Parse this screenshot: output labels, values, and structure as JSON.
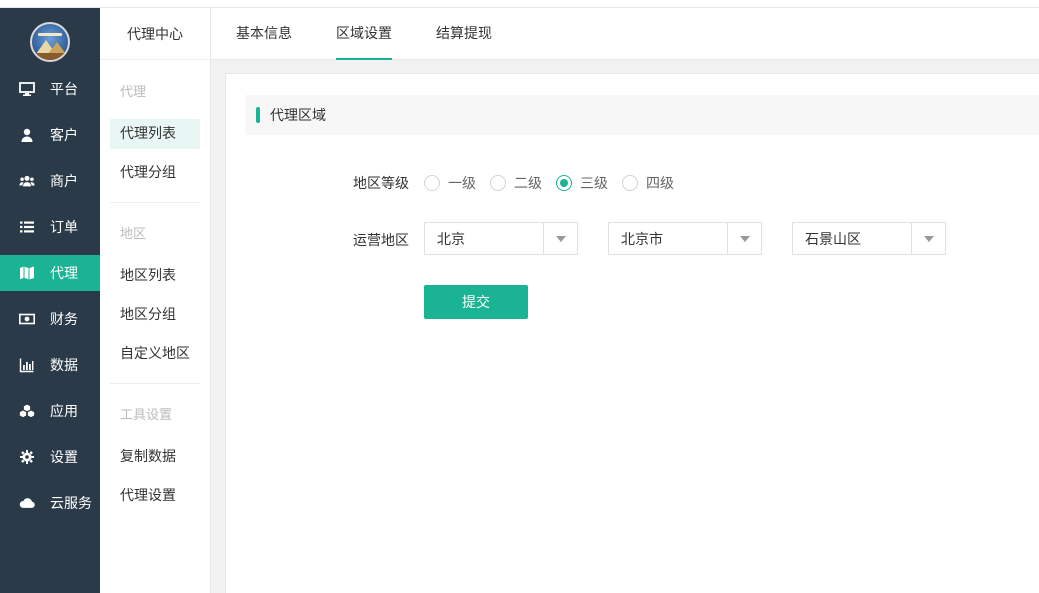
{
  "nav": {
    "items": [
      {
        "label": "平台",
        "icon": "monitor-icon"
      },
      {
        "label": "客户",
        "icon": "user-icon"
      },
      {
        "label": "商户",
        "icon": "users-icon"
      },
      {
        "label": "订单",
        "icon": "list-icon"
      },
      {
        "label": "代理",
        "icon": "map-icon"
      },
      {
        "label": "财务",
        "icon": "money-icon"
      },
      {
        "label": "数据",
        "icon": "bar-chart-icon"
      },
      {
        "label": "应用",
        "icon": "cubes-icon"
      },
      {
        "label": "设置",
        "icon": "gear-icon"
      },
      {
        "label": "云服务",
        "icon": "cloud-icon"
      }
    ],
    "active": "代理"
  },
  "sub": {
    "title": "代理中心",
    "groups": [
      {
        "head": "代理",
        "items": [
          "代理列表",
          "代理分组"
        ]
      },
      {
        "head": "地区",
        "items": [
          "地区列表",
          "地区分组",
          "自定义地区"
        ]
      },
      {
        "head": "工具设置",
        "items": [
          "复制数据",
          "代理设置"
        ]
      }
    ],
    "active": "代理列表"
  },
  "tabs": [
    "基本信息",
    "区域设置",
    "结算提现"
  ],
  "active_tab": "区域设置",
  "section_title": "代理区域",
  "form": {
    "level_label": "地区等级",
    "levels": [
      "一级",
      "二级",
      "三级",
      "四级"
    ],
    "selected_level": "三级",
    "region_label": "运营地区",
    "province": "北京",
    "city": "北京市",
    "district": "石景山区",
    "submit": "提交"
  },
  "colors": {
    "accent": "#1ab394",
    "nav_bg": "#2b3a48"
  }
}
